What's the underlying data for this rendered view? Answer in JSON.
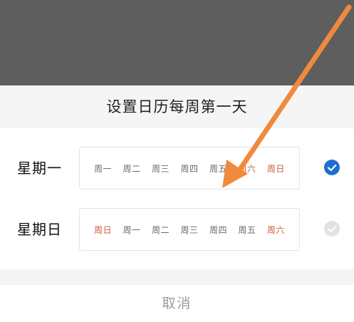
{
  "sheet": {
    "title": "设置日历每周第一天",
    "cancel_label": "取消"
  },
  "options": [
    {
      "label": "星期一",
      "selected": true,
      "days": [
        "周一",
        "周二",
        "周三",
        "周四",
        "周五",
        "周六",
        "周日"
      ],
      "weekend_flags": [
        false,
        false,
        false,
        false,
        false,
        true,
        true
      ]
    },
    {
      "label": "星期日",
      "selected": false,
      "days": [
        "周日",
        "周一",
        "周二",
        "周三",
        "周四",
        "周五",
        "周六"
      ],
      "weekend_flags": [
        true,
        false,
        false,
        false,
        false,
        false,
        true
      ]
    }
  ],
  "colors": {
    "accent": "#1c6fd1",
    "weekend": "#cf5a3a",
    "annotation_arrow": "#f08a3c",
    "overlay": "#5e5e5e"
  },
  "icons": {
    "selected": "check-circle-icon",
    "unselected": "check-circle-icon"
  }
}
